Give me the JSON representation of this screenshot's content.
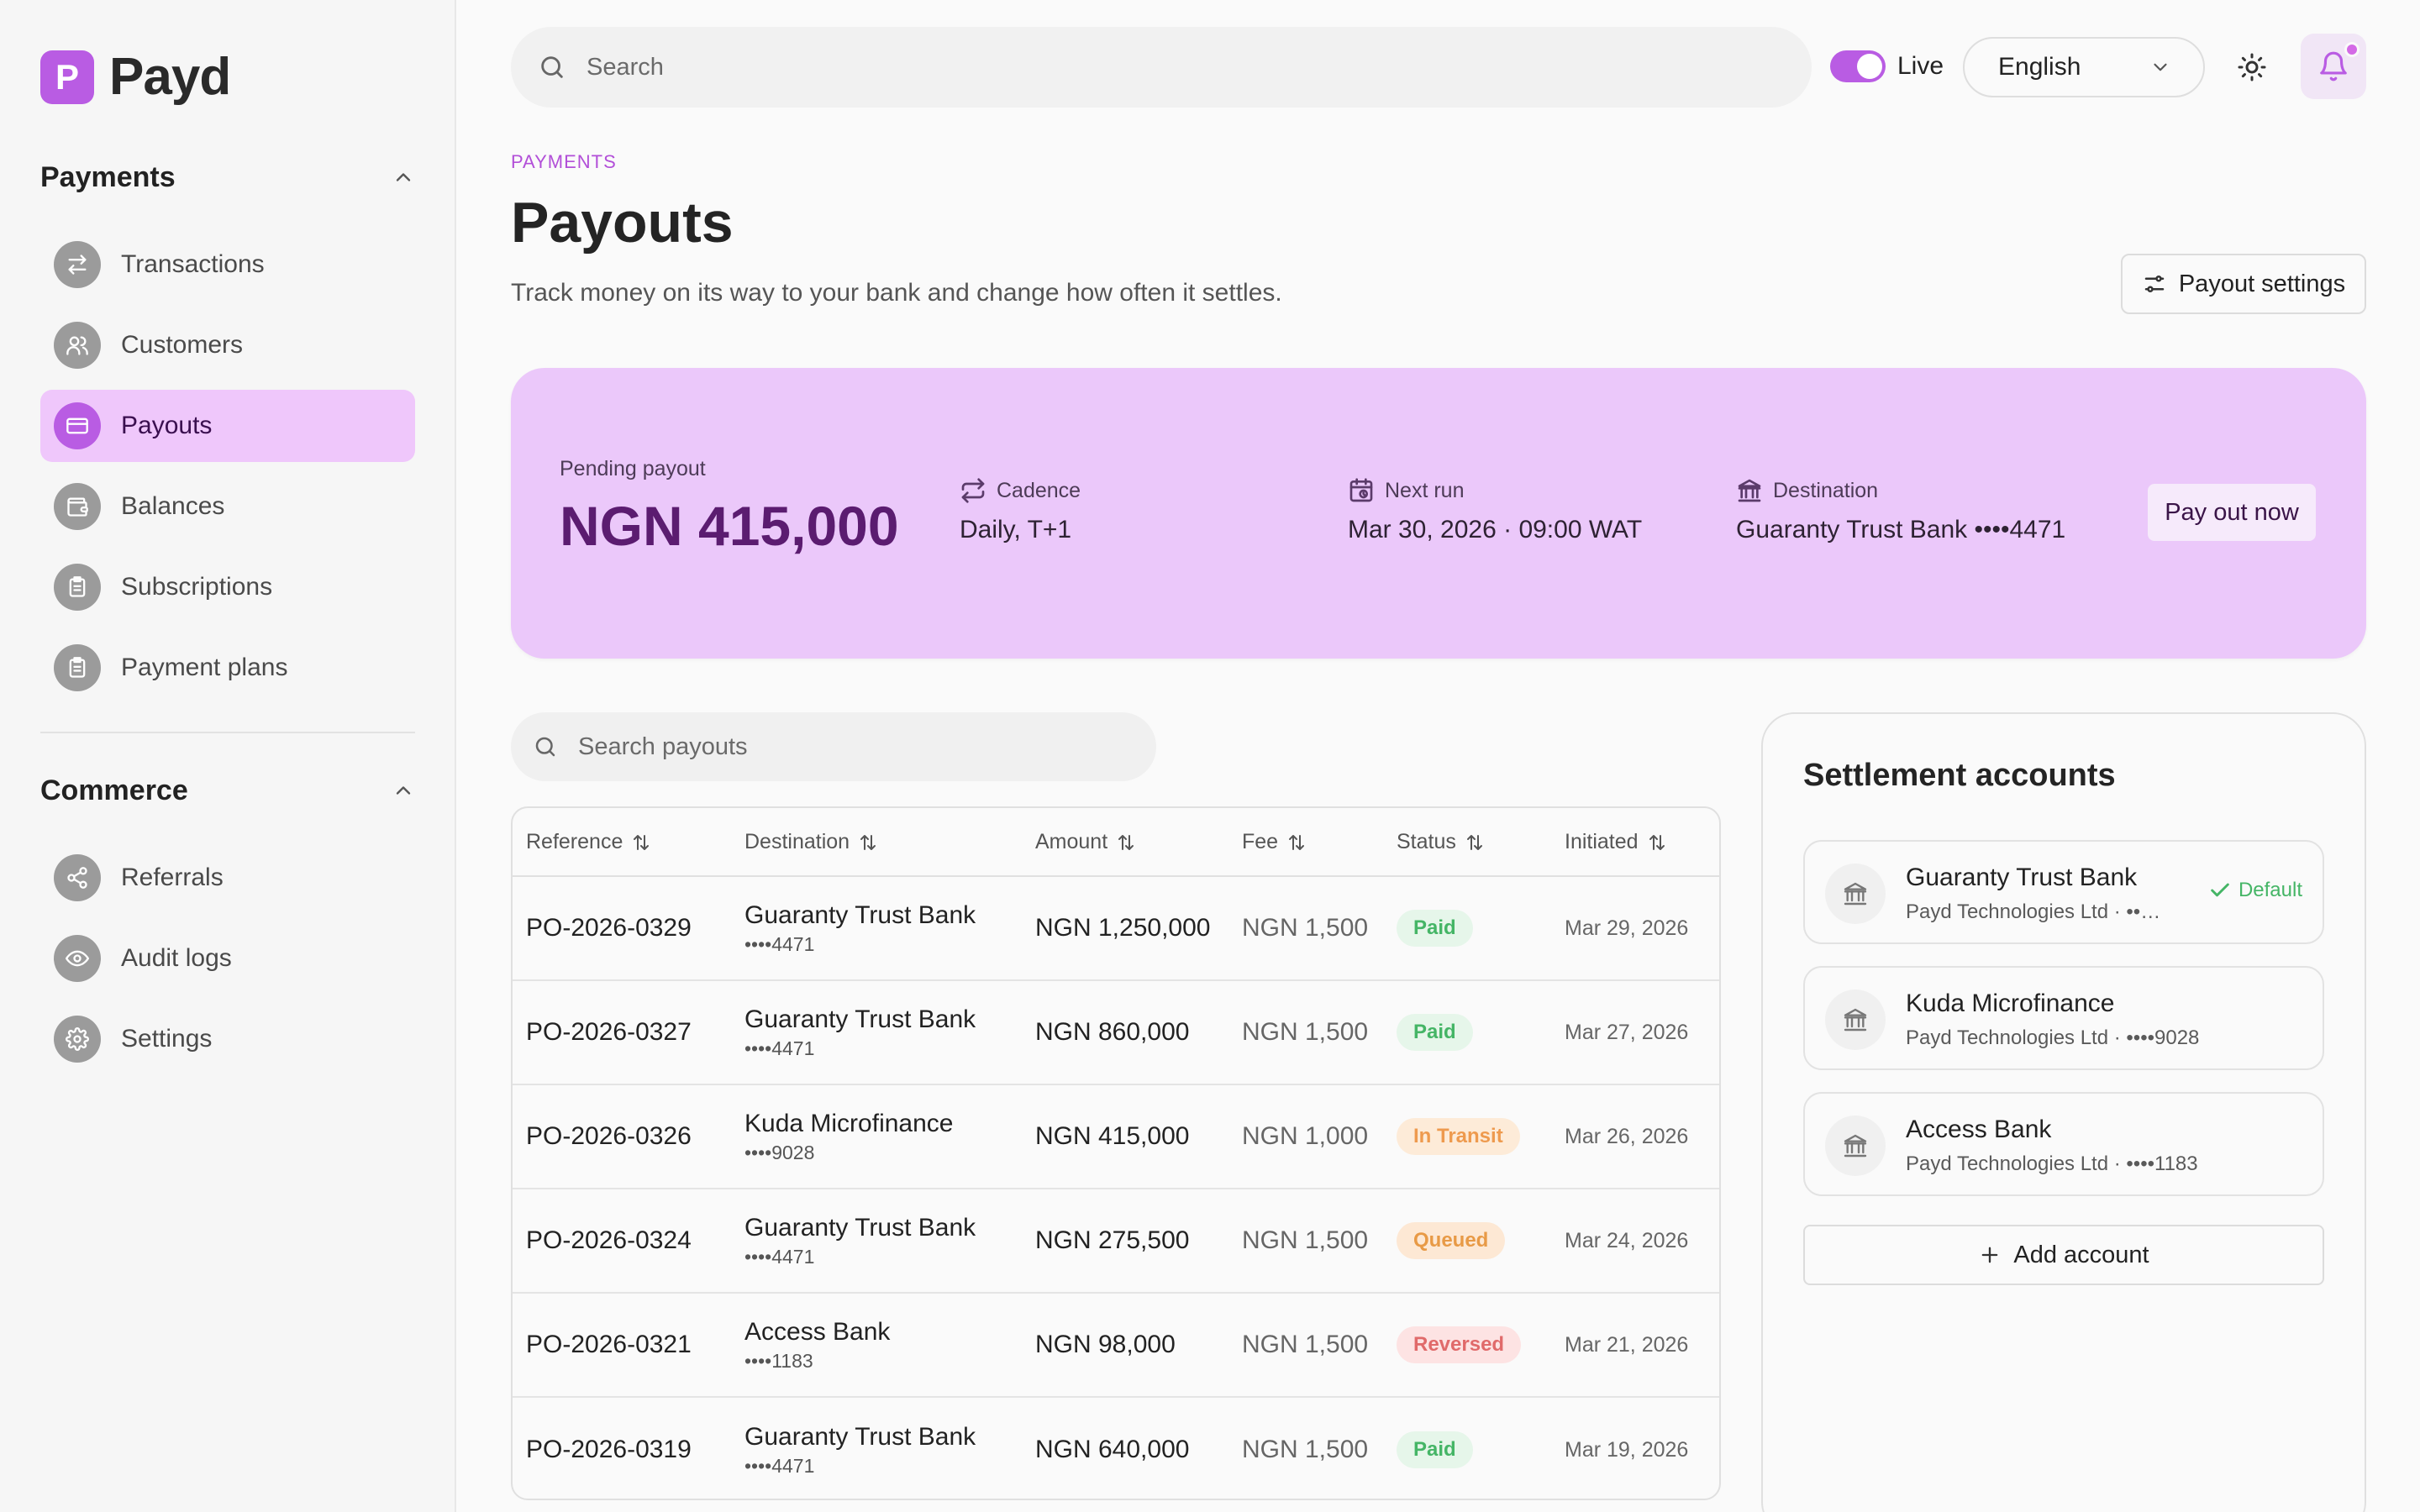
{
  "brand": {
    "letter": "P",
    "name": "Payd"
  },
  "sidebar": {
    "payments": {
      "title": "Payments",
      "items": [
        {
          "label": "Transactions",
          "icon": "arrows-swap-icon"
        },
        {
          "label": "Customers",
          "icon": "users-icon"
        },
        {
          "label": "Payouts",
          "icon": "card-icon",
          "active": true
        },
        {
          "label": "Balances",
          "icon": "wallet-icon"
        },
        {
          "label": "Subscriptions",
          "icon": "clipboard-icon"
        },
        {
          "label": "Payment plans",
          "icon": "clipboard-icon"
        }
      ]
    },
    "commerce": {
      "title": "Commerce",
      "items": [
        {
          "label": "Referrals",
          "icon": "share-icon"
        },
        {
          "label": "Audit logs",
          "icon": "eye-icon"
        },
        {
          "label": "Settings",
          "icon": "gear-icon"
        }
      ]
    }
  },
  "topbar": {
    "search_placeholder": "Search",
    "live_label": "Live",
    "live_on": true,
    "language": "English"
  },
  "header": {
    "eyebrow": "PAYMENTS",
    "title": "Payouts",
    "subtitle": "Track money on its way to your bank and change how often it settles.",
    "settings_button": "Payout settings"
  },
  "pending": {
    "label": "Pending payout",
    "amount": "NGN 415,000",
    "cadence_label": "Cadence",
    "cadence_value": "Daily, T+1",
    "next_run_label": "Next run",
    "next_run_value": "Mar 30, 2026 · 09:00 WAT",
    "destination_label": "Destination",
    "destination_value": "Guaranty Trust Bank ••••4471",
    "action": "Pay out now"
  },
  "table": {
    "search_placeholder": "Search payouts",
    "columns": [
      "Reference",
      "Destination",
      "Amount",
      "Fee",
      "Status",
      "Initiated"
    ],
    "rows": [
      {
        "reference": "PO-2026-0329",
        "bank": "Guaranty Trust Bank",
        "account": "••••4471",
        "amount": "NGN 1,250,000",
        "fee": "NGN 1,500",
        "status": "Paid",
        "status_type": "paid",
        "initiated": "Mar 29, 2026"
      },
      {
        "reference": "PO-2026-0327",
        "bank": "Guaranty Trust Bank",
        "account": "••••4471",
        "amount": "NGN 860,000",
        "fee": "NGN 1,500",
        "status": "Paid",
        "status_type": "paid",
        "initiated": "Mar 27, 2026"
      },
      {
        "reference": "PO-2026-0326",
        "bank": "Kuda Microfinance",
        "account": "••••9028",
        "amount": "NGN 415,000",
        "fee": "NGN 1,000",
        "status": "In Transit",
        "status_type": "transit",
        "initiated": "Mar 26, 2026"
      },
      {
        "reference": "PO-2026-0324",
        "bank": "Guaranty Trust Bank",
        "account": "••••4471",
        "amount": "NGN 275,500",
        "fee": "NGN 1,500",
        "status": "Queued",
        "status_type": "queued",
        "initiated": "Mar 24, 2026"
      },
      {
        "reference": "PO-2026-0321",
        "bank": "Access Bank",
        "account": "••••1183",
        "amount": "NGN 98,000",
        "fee": "NGN 1,500",
        "status": "Reversed",
        "status_type": "reversed",
        "initiated": "Mar 21, 2026"
      },
      {
        "reference": "PO-2026-0319",
        "bank": "Guaranty Trust Bank",
        "account": "••••4471",
        "amount": "NGN 640,000",
        "fee": "NGN 1,500",
        "status": "Paid",
        "status_type": "paid",
        "initiated": "Mar 19, 2026"
      }
    ]
  },
  "settlement": {
    "title": "Settlement accounts",
    "accounts": [
      {
        "name": "Guaranty Trust Bank",
        "sub": "Payd Technologies Ltd · ••…",
        "default_label": "Default"
      },
      {
        "name": "Kuda Microfinance",
        "sub": "Payd Technologies Ltd · ••••9028"
      },
      {
        "name": "Access Bank",
        "sub": "Payd Technologies Ltd · ••••1183"
      }
    ],
    "add_button": "Add account"
  },
  "colors": {
    "accent": "#b95ce3",
    "active_nav_bg": "#efc7fb",
    "card_bg": "#ebc8fa",
    "paid": "#45b566",
    "transit": "#ee9a4e",
    "reversed": "#e06a6a"
  }
}
